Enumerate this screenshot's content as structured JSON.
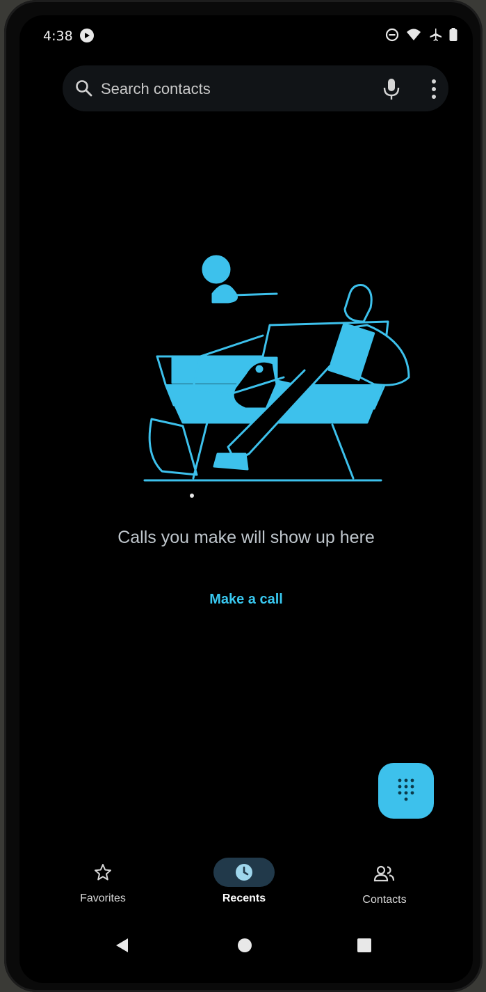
{
  "status_bar": {
    "time": "4:38"
  },
  "search": {
    "placeholder": "Search contacts"
  },
  "empty_state": {
    "message": "Calls you make will show up here",
    "action": "Make a call"
  },
  "bottom_nav": {
    "items": [
      {
        "label": "Favorites",
        "icon": "star-icon",
        "active": false
      },
      {
        "label": "Recents",
        "icon": "clock-icon",
        "active": true
      },
      {
        "label": "Contacts",
        "icon": "people-icon",
        "active": false
      }
    ]
  },
  "fab": {
    "icon": "dialpad-icon"
  },
  "colors": {
    "accent": "#3dc1ec",
    "active_pill": "#21394a",
    "background": "#000000"
  }
}
